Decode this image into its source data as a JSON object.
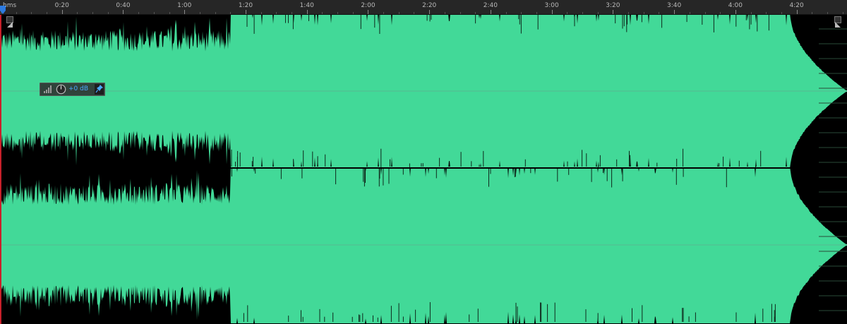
{
  "timeline": {
    "unit_label": "hms",
    "labels": [
      "0:20",
      "0:40",
      "1:00",
      "1:20",
      "1:40",
      "2:00",
      "2:20",
      "2:40",
      "3:00",
      "3:20",
      "3:40",
      "4:00",
      "4:20"
    ]
  },
  "waveform": {
    "duration_seconds": 275,
    "fade_out_start_seconds": 258,
    "dense_section_end_seconds": 75,
    "channels": 2,
    "color": "#42d998",
    "background": "#000000",
    "centerline_color": "#7f7f7f"
  },
  "hud": {
    "volume_value": "+0 dB",
    "volume_icon": "volume-ramp-icon",
    "knob_icon": "knob-icon",
    "pin_icon": "pin-icon",
    "accent": "#4aa8ff"
  },
  "colors": {
    "ruler_bg": "#262626",
    "playhead": "#2d7be0",
    "left_edge": "#c8202a"
  }
}
